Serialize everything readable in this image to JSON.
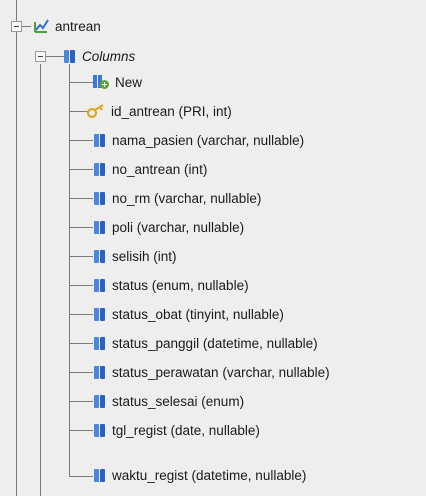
{
  "tree": {
    "table": {
      "name": "antrean",
      "icon": "table-icon"
    },
    "columns_group": {
      "label": "Columns",
      "icon": "columns-icon"
    },
    "new_item": {
      "label": "New",
      "icon": "new-column-icon"
    },
    "columns": [
      {
        "label": "id_antrean (PRI, int)",
        "icon": "key-icon"
      },
      {
        "label": "nama_pasien (varchar, nullable)",
        "icon": "column-icon"
      },
      {
        "label": "no_antrean (int)",
        "icon": "column-icon"
      },
      {
        "label": "no_rm (varchar, nullable)",
        "icon": "column-icon"
      },
      {
        "label": "poli (varchar, nullable)",
        "icon": "column-icon"
      },
      {
        "label": "selisih (int)",
        "icon": "column-icon"
      },
      {
        "label": "status (enum, nullable)",
        "icon": "column-icon"
      },
      {
        "label": "status_obat (tinyint, nullable)",
        "icon": "column-icon"
      },
      {
        "label": "status_panggil (datetime, nullable)",
        "icon": "column-icon"
      },
      {
        "label": "status_perawatan (varchar, nullable)",
        "icon": "column-icon"
      },
      {
        "label": "status_selesai (enum)",
        "icon": "column-icon"
      },
      {
        "label": "tgl_regist (date, nullable)",
        "icon": "column-icon"
      },
      {
        "label": "waktu_regist (datetime, nullable)",
        "icon": "column-icon"
      }
    ],
    "colors": {
      "background": "#eeeeee",
      "tree_line": "#7a7a7a",
      "column_icon_blue": "#2f6fd1",
      "key_icon_gold": "#e0a826",
      "new_icon_green": "#5aa832",
      "table_icon_green": "#4aa33a"
    }
  }
}
